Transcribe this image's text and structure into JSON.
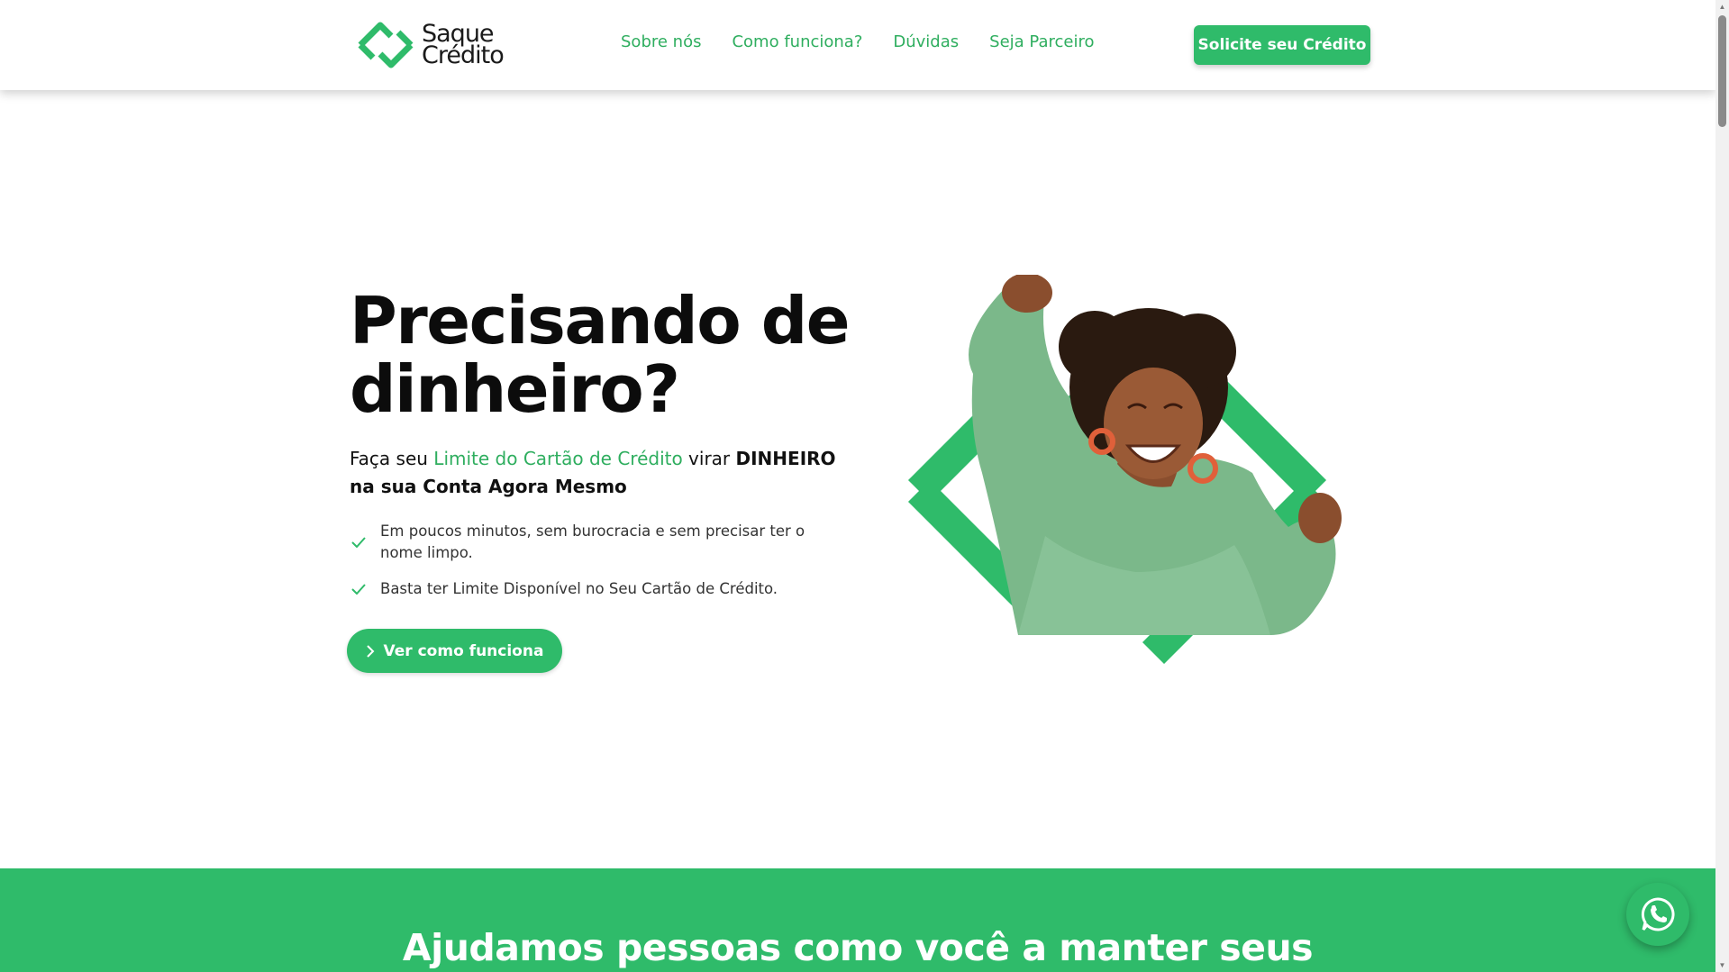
{
  "header": {
    "logo_line1": "Saque",
    "logo_line2": "Crédito",
    "nav": [
      "Sobre nós",
      "Como funciona?",
      "Dúvidas",
      "Seja Parceiro"
    ],
    "cta_label": "Solicite seu Crédito"
  },
  "hero": {
    "title": "Precisando de dinheiro?",
    "sub_before": "Faça seu ",
    "sub_highlight": "Limite do Cartão de Crédito",
    "sub_middle": " virar ",
    "sub_bold": "DINHEIRO na sua Conta Agora Mesmo",
    "checklist": [
      "Em poucos minutos, sem burocracia e sem precisar ter o nome limpo.",
      "Basta ter Limite Disponível no Seu Cartão de Crédito."
    ],
    "button_label": "Ver como funciona"
  },
  "band": {
    "title": "Ajudamos pessoas como você a manter seus"
  },
  "colors": {
    "brand_green": "#2fbb6a",
    "link_green": "#2fae5f"
  },
  "icons": {
    "logo": "saque-credito-logo-icon",
    "check": "check-icon",
    "chevron": "chevron-right-icon",
    "whatsapp": "whatsapp-icon"
  }
}
